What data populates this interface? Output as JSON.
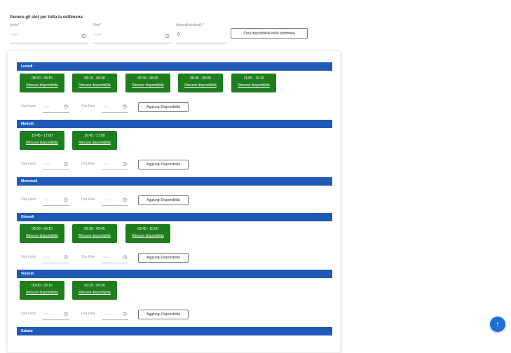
{
  "page": {
    "title": "Genera gli slot per tutta la settimana",
    "start_label": "Inizio*",
    "start_value": "--:--",
    "end_label": "Fine*",
    "end_value": "--:--",
    "interval_label": "Intervallo(minuti) *",
    "interval_value": "0",
    "create_button": "Crea disponibilità della settimana"
  },
  "days": [
    {
      "name": "Lunedì",
      "slots": [
        {
          "time": "08:00 - 08:15",
          "action": "Rimuovi disponibilità"
        },
        {
          "time": "08:15 - 08:30",
          "action": "Rimuovi disponibilità"
        },
        {
          "time": "08:30 - 08:45",
          "action": "Rimuovi disponibilità"
        },
        {
          "time": "08:45 - 09:00",
          "action": "Rimuovi disponibilità"
        },
        {
          "time": "11:00 - 11:15",
          "action": "Rimuovi disponibilità"
        }
      ]
    },
    {
      "name": "Martedì",
      "slots": [
        {
          "time": "16:45 - 17:00",
          "action": "Rimuovi disponibilità"
        },
        {
          "time": "16:45 - 17:00",
          "action": "Rimuovi disponibilità"
        }
      ]
    },
    {
      "name": "Mercoledì",
      "slots": []
    },
    {
      "name": "Giovedì",
      "slots": [
        {
          "time": "09:00 - 09:15",
          "action": "Rimuovi disponibilità"
        },
        {
          "time": "09:30 - 09:45",
          "action": "Rimuovi disponibilità"
        },
        {
          "time": "09:45 - 10:00",
          "action": "Rimuovi disponibilità"
        }
      ]
    },
    {
      "name": "Venerdì",
      "slots": [
        {
          "time": "09:00 - 09:15",
          "action": "Rimuovi disponibilità"
        },
        {
          "time": "09:15 - 09:30",
          "action": "Rimuovi disponibilità"
        }
      ]
    },
    {
      "name": "Sabato",
      "slots": []
    }
  ],
  "add_row": {
    "from_label": "Ora Inizio",
    "from_value": "--:--",
    "to_label": "Ora Fine",
    "to_value": "--:--",
    "button": "Aggiungi Disponibilità"
  },
  "fab": {
    "icon": "arrow-up-icon"
  }
}
